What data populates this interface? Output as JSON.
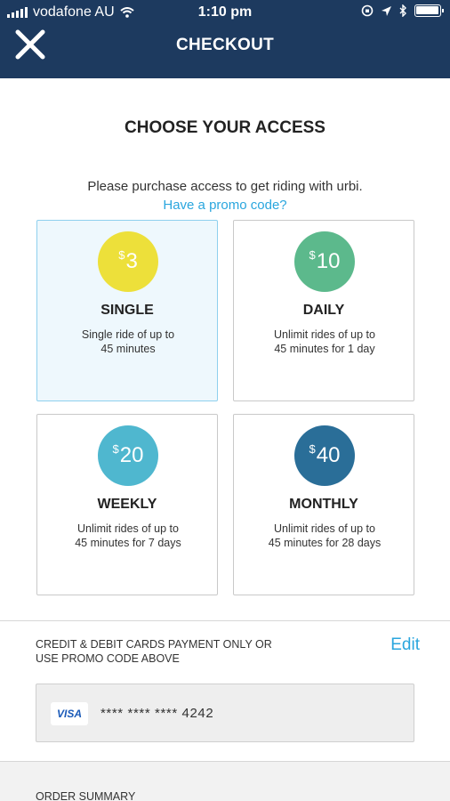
{
  "status_bar": {
    "carrier": "vodafone AU",
    "time": "1:10 pm"
  },
  "header": {
    "title": "CHECKOUT",
    "close_icon": "close-icon"
  },
  "main": {
    "heading": "CHOOSE YOUR ACCESS",
    "subtitle": "Please purchase access to get riding with urbi.",
    "promo_link": "Have a promo code?"
  },
  "plans": [
    {
      "currency": "$",
      "amount": "3",
      "name": "SINGLE",
      "desc1": "Single ride of up to",
      "desc2": "45 minutes",
      "color": "#ede03a",
      "selected": true
    },
    {
      "currency": "$",
      "amount": "10",
      "name": "DAILY",
      "desc1": "Unlimit rides of up to",
      "desc2": "45 minutes for 1 day",
      "color": "#5cb98c",
      "selected": false
    },
    {
      "currency": "$",
      "amount": "20",
      "name": "WEEKLY",
      "desc1": "Unlimit rides of up to",
      "desc2": "45 minutes for 7 days",
      "color": "#4fb7cf",
      "selected": false
    },
    {
      "currency": "$",
      "amount": "40",
      "name": "MONTHLY",
      "desc1": "Unlimit rides of up to",
      "desc2": "45 minutes for 28 days",
      "color": "#2a6e98",
      "selected": false
    }
  ],
  "payment": {
    "note_line1": "CREDIT & DEBIT CARDS PAYMENT ONLY OR",
    "note_line2": "USE PROMO CODE ABOVE",
    "edit_label": "Edit",
    "card_brand": "VISA",
    "card_number": "**** **** **** 4242"
  },
  "order_summary": {
    "label": "ORDER SUMMARY"
  },
  "colors": {
    "header_bg": "#1d3a5f",
    "accent": "#2aa6de"
  }
}
